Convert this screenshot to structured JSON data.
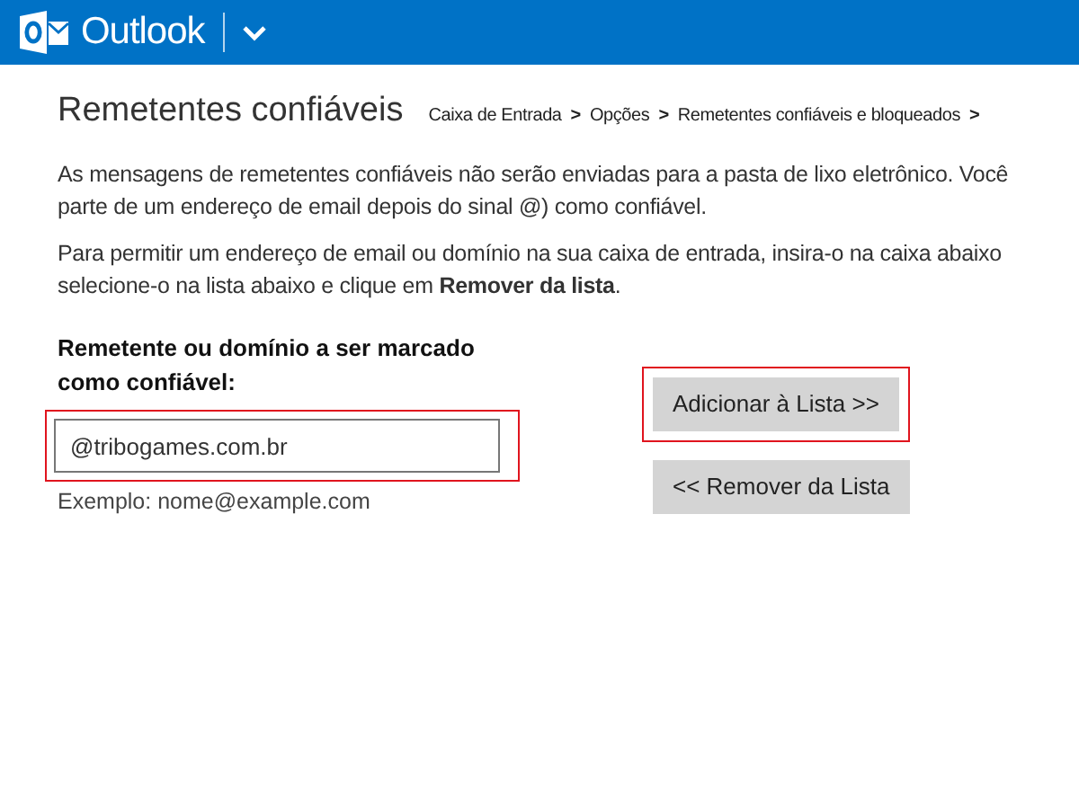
{
  "header": {
    "app_name": "Outlook"
  },
  "page_title": "Remetentes confiáveis",
  "breadcrumb": [
    {
      "label": "Caixa de Entrada",
      "separator": ">"
    },
    {
      "label": "Opções",
      "separator": ">"
    },
    {
      "label": "Remetentes confiáveis e bloqueados",
      "separator": ">"
    }
  ],
  "paragraphs": [
    [
      "As mensagens de remetentes confiáveis não serão enviadas para a pasta de lixo eletrônico. Você",
      "parte de um endereço de email depois do sinal @) como confiável."
    ],
    [
      "Para permitir um endereço de email ou domínio na sua caixa de entrada, insira-o na caixa abaixo",
      "selecione-o na lista abaixo e clique em **Remover da lista**."
    ]
  ],
  "sender_field": {
    "label": "Remetente ou domínio a ser marcado como confiável:",
    "value": "@tribogames.com.br",
    "hint": "Exemplo: nome@example.com",
    "highlighted": true
  },
  "buttons": [
    {
      "label": "Adicionar à Lista >>",
      "highlighted": true
    },
    {
      "label": "<< Remover da Lista",
      "highlighted": false
    }
  ]
}
